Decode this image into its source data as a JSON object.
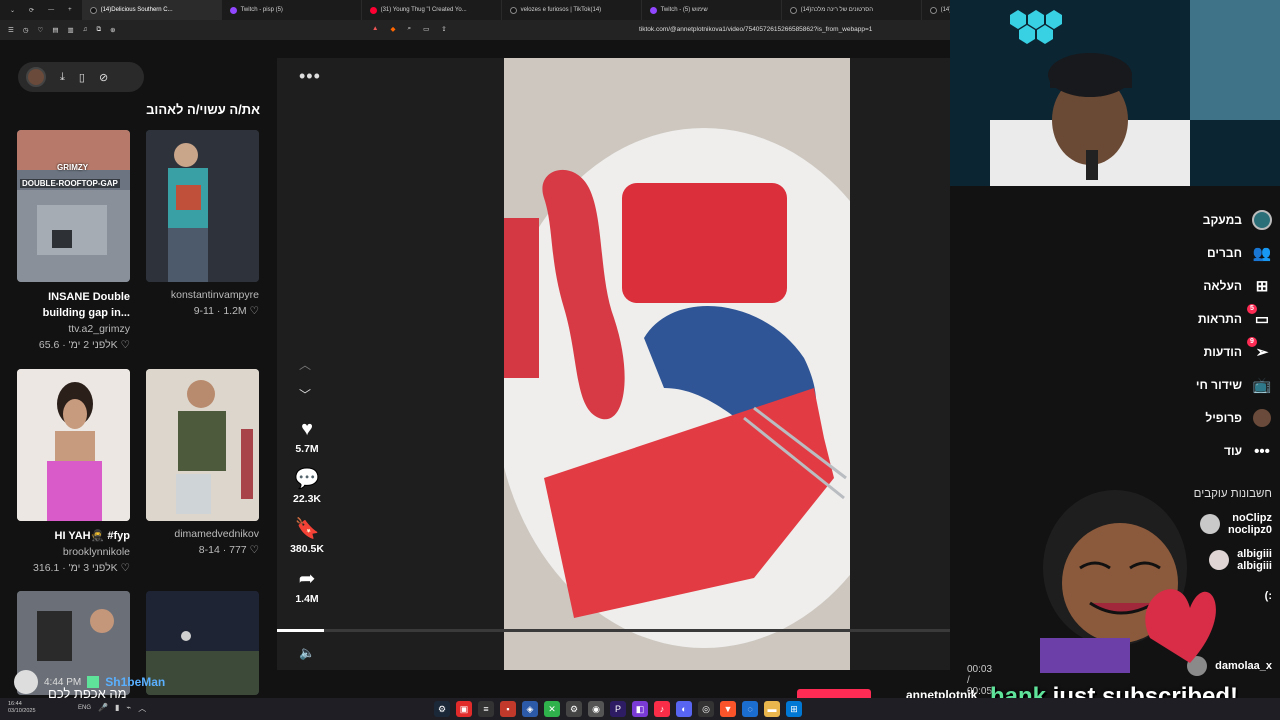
{
  "browser": {
    "tabs": [
      {
        "title": "(14)Delicious Southern C...",
        "active": true,
        "kind": "tt"
      },
      {
        "title": "Twitch - pisp (5)",
        "kind": "twitch"
      },
      {
        "title": "(31) Young Thug \"I Created Yo...",
        "kind": "yt"
      },
      {
        "title": "velozes e furiosos | TikTok(14)",
        "kind": "tt"
      },
      {
        "title": "Twitch - שימוש (5)",
        "kind": "twitch"
      },
      {
        "title": "(14)הסרטונים של רינה מלכה",
        "kind": "tt"
      },
      {
        "title": "(14)Flotilla de la Libertad: Hum...",
        "kind": "tt"
      },
      {
        "title": "(5) xd - Twitch",
        "kind": "twitch"
      }
    ],
    "url": "tiktok.com/@annetplotnikova1/video/7540572615266585862?is_from_webapp=1"
  },
  "top_controls": {
    "icons": [
      "avatar",
      "download-icon",
      "phone-icon",
      "compass-icon"
    ]
  },
  "recommended": {
    "title": "את/ה עשוי/ה לאהוב",
    "cards": [
      {
        "caption": "INSANE Double building gap in...",
        "author": "ttv.a2_grimzy",
        "likes": "65.6K",
        "age": "לפני 2 ימ'"
      },
      {
        "caption": "",
        "author": "konstantinvampyre",
        "likes": "1.2M",
        "age": "9-11"
      },
      {
        "caption": "HI YAH🥷 #fyp",
        "author": "brooklynnikole",
        "likes": "316.1K",
        "age": "לפני 3 ימ'"
      },
      {
        "caption": "",
        "author": "dimamedvednikov",
        "likes": "777",
        "age": "8-14"
      }
    ],
    "thumb_text": {
      "grimzy": "GRIMZY",
      "rooftop": "DOUBLE-ROOFTOP-GAP"
    }
  },
  "player": {
    "likes": "5.7M",
    "comments": "22.3K",
    "saves": "380.5K",
    "shares": "1.4M",
    "time": "00:03 / 00:05",
    "progress": 0.07,
    "author": "annetplotnik"
  },
  "right_nav": {
    "items": [
      {
        "label": "במעקב",
        "icon": "following-avatar-icon"
      },
      {
        "label": "חברים",
        "icon": "friends-icon"
      },
      {
        "label": "העלאה",
        "icon": "upload-icon"
      },
      {
        "label": "התראות",
        "icon": "activity-icon",
        "badge": "5"
      },
      {
        "label": "הודעות",
        "icon": "messages-icon",
        "badge": "9"
      },
      {
        "label": "שידור חי",
        "icon": "live-icon"
      },
      {
        "label": "פרופיל",
        "icon": "profile-avatar-icon"
      },
      {
        "label": "עוד",
        "icon": "more-dots-icon"
      }
    ],
    "following_title": "חשבונות עוקבים",
    "following": [
      {
        "name": "noClipz",
        "handle": "noclipz0"
      },
      {
        "name": "albigiii",
        "handle": "albigiii"
      },
      {
        "name": "(:",
        "handle": ""
      },
      {
        "name": "damolaa_x",
        "handle": ""
      }
    ]
  },
  "overlay": {
    "sub_name": "hank",
    "sub_text": " just subscribed!",
    "chat_time": "4:44 PM",
    "chat_user": "Sh1beMan",
    "chat_msg": "מה אכפת לכם"
  },
  "taskbar": {
    "time": "16:44",
    "date": "03/10/2025",
    "lang": "ENG"
  }
}
